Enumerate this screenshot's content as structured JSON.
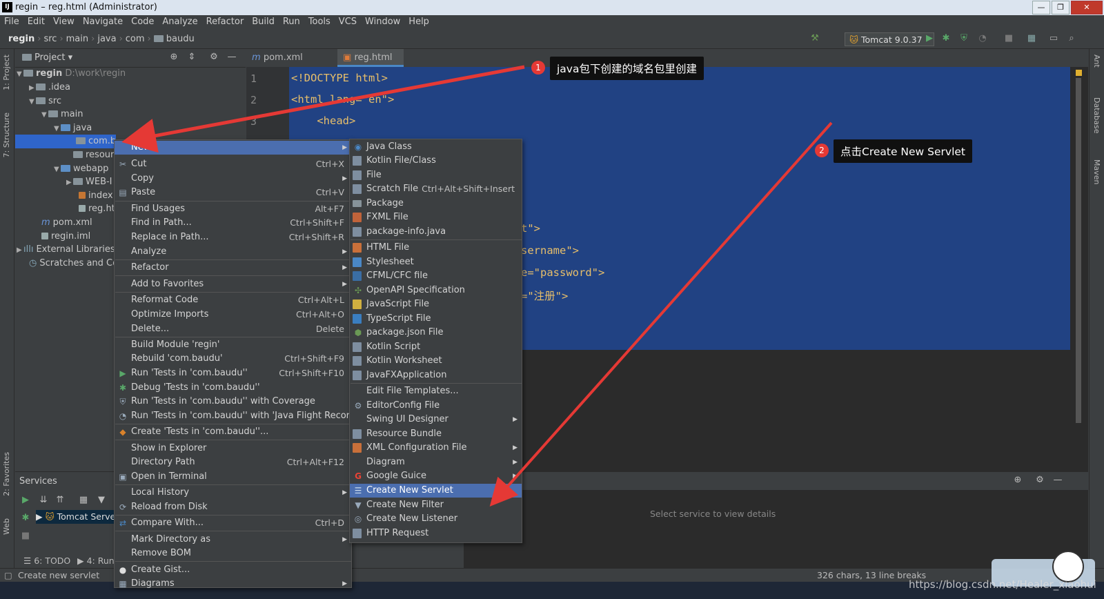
{
  "window": {
    "title": "regin – reg.html (Administrator)"
  },
  "menubar": [
    "File",
    "Edit",
    "View",
    "Navigate",
    "Code",
    "Analyze",
    "Refactor",
    "Build",
    "Run",
    "Tools",
    "VCS",
    "Window",
    "Help"
  ],
  "breadcrumb": [
    "regin",
    "src",
    "main",
    "java",
    "com",
    "baudu"
  ],
  "run_config": "Tomcat 9.0.37",
  "project_panel": {
    "title": "Project"
  },
  "tree": [
    {
      "label": "regin",
      "extra": "D:\\work\\regin"
    },
    {
      "label": ".idea"
    },
    {
      "label": "src"
    },
    {
      "label": "main"
    },
    {
      "label": "java"
    },
    {
      "label": "com.b"
    },
    {
      "label": "resources"
    },
    {
      "label": "webapp"
    },
    {
      "label": "WEB-I"
    },
    {
      "label": "index.j"
    },
    {
      "label": "reg.htı"
    },
    {
      "label": "pom.xml"
    },
    {
      "label": "regin.iml"
    },
    {
      "label": "External Libraries"
    },
    {
      "label": "Scratches and Con"
    }
  ],
  "left_tools": [
    "1: Project",
    "7: Structure",
    "2: Favorites",
    "Web"
  ],
  "right_tools": [
    "Ant",
    "Database",
    "Maven"
  ],
  "tabs": [
    {
      "label": "pom.xml (regin)"
    },
    {
      "label": "reg.html"
    }
  ],
  "code_lines": [
    {
      "n": "1",
      "text": "<!DOCTYPE html>"
    },
    {
      "n": "2",
      "text": "<html lang=\"en\">"
    },
    {
      "n": "3",
      "text": "    <head>"
    }
  ],
  "code_fragments": [
    "t\">",
    "sername\">",
    "e=\"password\">",
    "=\"注册\">"
  ],
  "context_menu": {
    "items": [
      {
        "label": "New",
        "shortcut": "",
        "submenu": true,
        "highlight": true
      },
      {
        "label": "Cut",
        "shortcut": "Ctrl+X",
        "icon": "✂"
      },
      {
        "label": "Copy",
        "shortcut": "",
        "submenu": true
      },
      {
        "label": "Paste",
        "shortcut": "Ctrl+V",
        "icon": "📋"
      },
      {
        "label": "Find Usages",
        "shortcut": "Alt+F7"
      },
      {
        "label": "Find in Path...",
        "shortcut": "Ctrl+Shift+F"
      },
      {
        "label": "Replace in Path...",
        "shortcut": "Ctrl+Shift+R"
      },
      {
        "label": "Analyze",
        "shortcut": "",
        "submenu": true
      },
      {
        "label": "Refactor",
        "shortcut": "",
        "submenu": true
      },
      {
        "label": "Add to Favorites",
        "shortcut": "",
        "submenu": true
      },
      {
        "label": "Reformat Code",
        "shortcut": "Ctrl+Alt+L"
      },
      {
        "label": "Optimize Imports",
        "shortcut": "Ctrl+Alt+O"
      },
      {
        "label": "Delete...",
        "shortcut": "Delete"
      },
      {
        "label": "Build Module 'regin'",
        "shortcut": ""
      },
      {
        "label": "Rebuild 'com.baudu'",
        "shortcut": "Ctrl+Shift+F9"
      },
      {
        "label": "Run 'Tests in 'com.baudu''",
        "shortcut": "Ctrl+Shift+F10",
        "icon": "▶"
      },
      {
        "label": "Debug 'Tests in 'com.baudu''",
        "shortcut": "",
        "icon": "🐞"
      },
      {
        "label": "Run 'Tests in 'com.baudu'' with Coverage",
        "shortcut": ""
      },
      {
        "label": "Run 'Tests in 'com.baudu'' with 'Java Flight Recorder'",
        "shortcut": ""
      },
      {
        "label": "Create 'Tests in 'com.baudu''...",
        "shortcut": ""
      },
      {
        "label": "Show in Explorer",
        "shortcut": ""
      },
      {
        "label": "Directory Path",
        "shortcut": "Ctrl+Alt+F12"
      },
      {
        "label": "Open in Terminal",
        "shortcut": ""
      },
      {
        "label": "Local History",
        "shortcut": "",
        "submenu": true
      },
      {
        "label": "Reload from Disk",
        "shortcut": ""
      },
      {
        "label": "Compare With...",
        "shortcut": "Ctrl+D"
      },
      {
        "label": "Mark Directory as",
        "shortcut": "",
        "submenu": true
      },
      {
        "label": "Remove BOM",
        "shortcut": ""
      },
      {
        "label": "Create Gist...",
        "shortcut": ""
      },
      {
        "label": "Diagrams",
        "shortcut": "",
        "submenu": true
      }
    ]
  },
  "new_submenu": {
    "items": [
      {
        "label": "Java Class",
        "shortcut": ""
      },
      {
        "label": "Kotlin File/Class",
        "shortcut": ""
      },
      {
        "label": "File",
        "shortcut": ""
      },
      {
        "label": "Scratch File",
        "shortcut": "Ctrl+Alt+Shift+Insert"
      },
      {
        "label": "Package",
        "shortcut": ""
      },
      {
        "label": "FXML File",
        "shortcut": ""
      },
      {
        "label": "package-info.java",
        "shortcut": ""
      },
      {
        "label": "HTML File",
        "shortcut": ""
      },
      {
        "label": "Stylesheet",
        "shortcut": ""
      },
      {
        "label": "CFML/CFC file",
        "shortcut": ""
      },
      {
        "label": "OpenAPI Specification",
        "shortcut": ""
      },
      {
        "label": "JavaScript File",
        "shortcut": ""
      },
      {
        "label": "TypeScript File",
        "shortcut": ""
      },
      {
        "label": "package.json File",
        "shortcut": ""
      },
      {
        "label": "Kotlin Script",
        "shortcut": ""
      },
      {
        "label": "Kotlin Worksheet",
        "shortcut": ""
      },
      {
        "label": "JavaFXApplication",
        "shortcut": ""
      },
      {
        "label": "Edit File Templates...",
        "shortcut": ""
      },
      {
        "label": "EditorConfig File",
        "shortcut": ""
      },
      {
        "label": "Swing UI Designer",
        "shortcut": "",
        "submenu": true
      },
      {
        "label": "Resource Bundle",
        "shortcut": ""
      },
      {
        "label": "XML Configuration File",
        "shortcut": "",
        "submenu": true
      },
      {
        "label": "Diagram",
        "shortcut": "",
        "submenu": true
      },
      {
        "label": "Google Guice",
        "shortcut": "",
        "submenu": true
      },
      {
        "label": "Create New Servlet",
        "shortcut": "",
        "highlight": true
      },
      {
        "label": "Create New Filter",
        "shortcut": ""
      },
      {
        "label": "Create New Listener",
        "shortcut": ""
      },
      {
        "label": "HTTP Request",
        "shortcut": ""
      }
    ]
  },
  "services": {
    "title": "Services",
    "tomcat": "Tomcat Serve",
    "empty": "Select service to view details"
  },
  "bottom_tools": [
    "6: TODO",
    "4: Run"
  ],
  "status": {
    "left": "Create new servlet",
    "right": "326 chars, 13 line breaks"
  },
  "annotations": [
    {
      "num": "1",
      "text": "java包下创建的域名包里创建"
    },
    {
      "num": "2",
      "text": "点击Create New Servlet"
    }
  ],
  "watermark": "https://blog.csdn.net/Healer_xiaohui",
  "colors": {
    "selection": "#214283",
    "highlight": "#4b6eaf",
    "arrow": "#e53935"
  }
}
